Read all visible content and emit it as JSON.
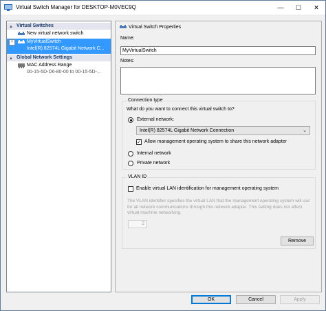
{
  "window": {
    "title": "Virtual Switch Manager for DESKTOP-M0VEC9Q",
    "controls": {
      "minimize": "—",
      "maximize": "☐",
      "close": "✕"
    }
  },
  "left_pane": {
    "sections": [
      {
        "label": "Virtual Switches",
        "toggle": "▲"
      },
      {
        "label": "Global Network Settings",
        "toggle": "▲"
      }
    ],
    "items": {
      "new_switch": "New virtual network switch",
      "switch_name": "MyVirtualSwitch",
      "switch_adapter": "Intel(R) 82574L Gigabit Network C...",
      "expand_glyph": "+",
      "mac_title": "MAC Address Range",
      "mac_range": "00-15-5D-D6-80-00 to 00-15-5D-..."
    }
  },
  "properties": {
    "header": "Virtual Switch Properties",
    "name_label": "Name:",
    "name_value": "MyVirtualSwitch",
    "notes_label": "Notes:",
    "notes_value": ""
  },
  "connection_type": {
    "title": "Connection type",
    "question": "What do you want to connect this virtual switch to?",
    "external_label": "External network:",
    "adapter_selected": "Intel(R) 82574L Gigabit Network Connection",
    "allow_mgmt_label": "Allow management operating system to share this network adapter",
    "allow_mgmt_checked": true,
    "internal_label": "Internal network",
    "private_label": "Private network",
    "selected": "external"
  },
  "vlan": {
    "title": "VLAN ID",
    "enable_label": "Enable virtual LAN identification for management operating system",
    "enable_checked": false,
    "description": "The VLAN identifier specifies the virtual LAN that the management operating system will use for all network communications through this network adapter. This setting does not affect virtual machine networking.",
    "id_value": "2"
  },
  "buttons": {
    "remove": "Remove",
    "ok": "OK",
    "cancel": "Cancel",
    "apply": "Apply"
  },
  "colors": {
    "selection": "#3399ff",
    "section_header": "#1b3b6b",
    "default_button_border": "#0078d7"
  }
}
